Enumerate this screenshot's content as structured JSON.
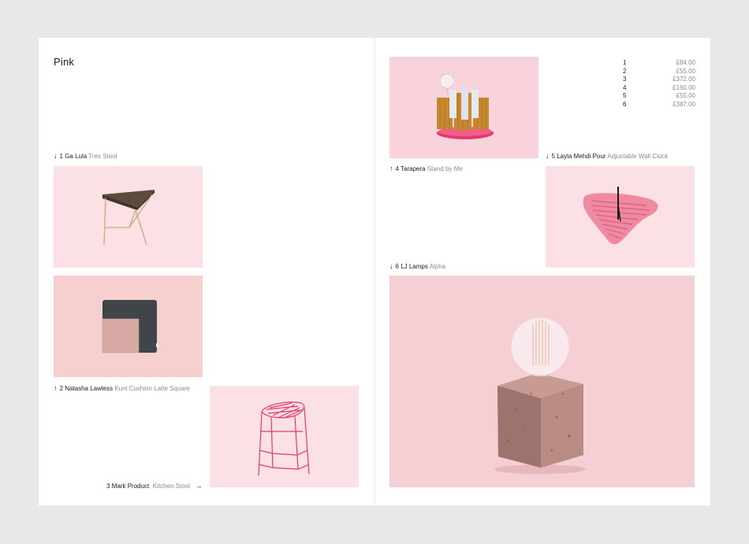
{
  "page": {
    "title": "Pink"
  },
  "products": [
    {
      "num": "1",
      "designer": "Ga Lula",
      "product": "Tres Stool",
      "arrow": "↓"
    },
    {
      "num": "2",
      "designer": "Natasha Lawless",
      "product": "Kuni Cushion Latte Square",
      "arrow": "↑"
    },
    {
      "num": "3",
      "designer": "Mark Product",
      "product": "Kitchen Stool",
      "arrow": "→"
    },
    {
      "num": "4",
      "designer": "Tarapera",
      "product": "Stand by Me",
      "arrow": "↑"
    },
    {
      "num": "5",
      "designer": "Layla Mehdi Pour",
      "product": "Adjustable Wall Clock",
      "arrow": "↓"
    },
    {
      "num": "6",
      "designer": "LJ Lamps",
      "product": "Alpha",
      "arrow": "↓"
    }
  ],
  "prices": [
    {
      "num": "1",
      "amount": "£84.00"
    },
    {
      "num": "2",
      "amount": "£55.00"
    },
    {
      "num": "3",
      "amount": "£372.00"
    },
    {
      "num": "4",
      "amount": "£160.00"
    },
    {
      "num": "5",
      "amount": "£55.00"
    },
    {
      "num": "6",
      "amount": "£387.00"
    }
  ],
  "colors": {
    "pink_light": "#fbe1e6",
    "pink_mid": "#f6cfd4",
    "pink_salmon": "#f7cfcf",
    "accent": "#e23a6a"
  }
}
